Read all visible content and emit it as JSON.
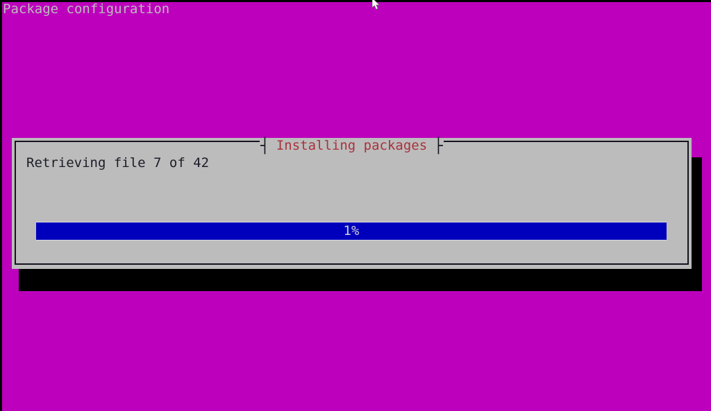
{
  "screen": {
    "title": "Package configuration",
    "background_color": "#bc00bc",
    "title_color": "#bcbcbc",
    "cursor_icon": "mouse-pointer-icon"
  },
  "dialog": {
    "title": "Installing packages",
    "title_color": "#a8323c",
    "background_color": "#bcbcbc",
    "border_color": "#14141e",
    "title_separator_left": "┤",
    "title_separator_right": "├",
    "message": "Retrieving file 7 of 42",
    "message_color": "#1c1c28",
    "shadow_color": "#000000"
  },
  "progress": {
    "percent": 1,
    "label": "1%",
    "fill_color": "#0000bc",
    "track_color": "#bcbcbc",
    "label_color": "#d0d0d8"
  }
}
